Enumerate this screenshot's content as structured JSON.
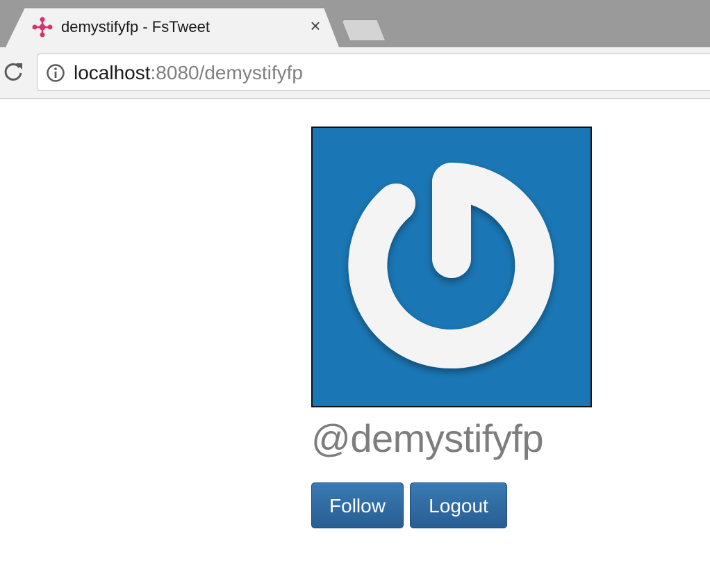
{
  "browser": {
    "tab_title": "demystifyfp - FsTweet",
    "close_glyph": "×",
    "url_host": "localhost",
    "url_rest": ":8080/demystifyfp"
  },
  "profile": {
    "username": "@demystifyfp",
    "avatar_color": "#1a76b4"
  },
  "actions": {
    "follow_label": "Follow",
    "logout_label": "Logout"
  },
  "icons": {
    "favicon": "molecule-icon",
    "reload": "reload-icon",
    "info": "info-icon",
    "avatar": "power-icon"
  }
}
